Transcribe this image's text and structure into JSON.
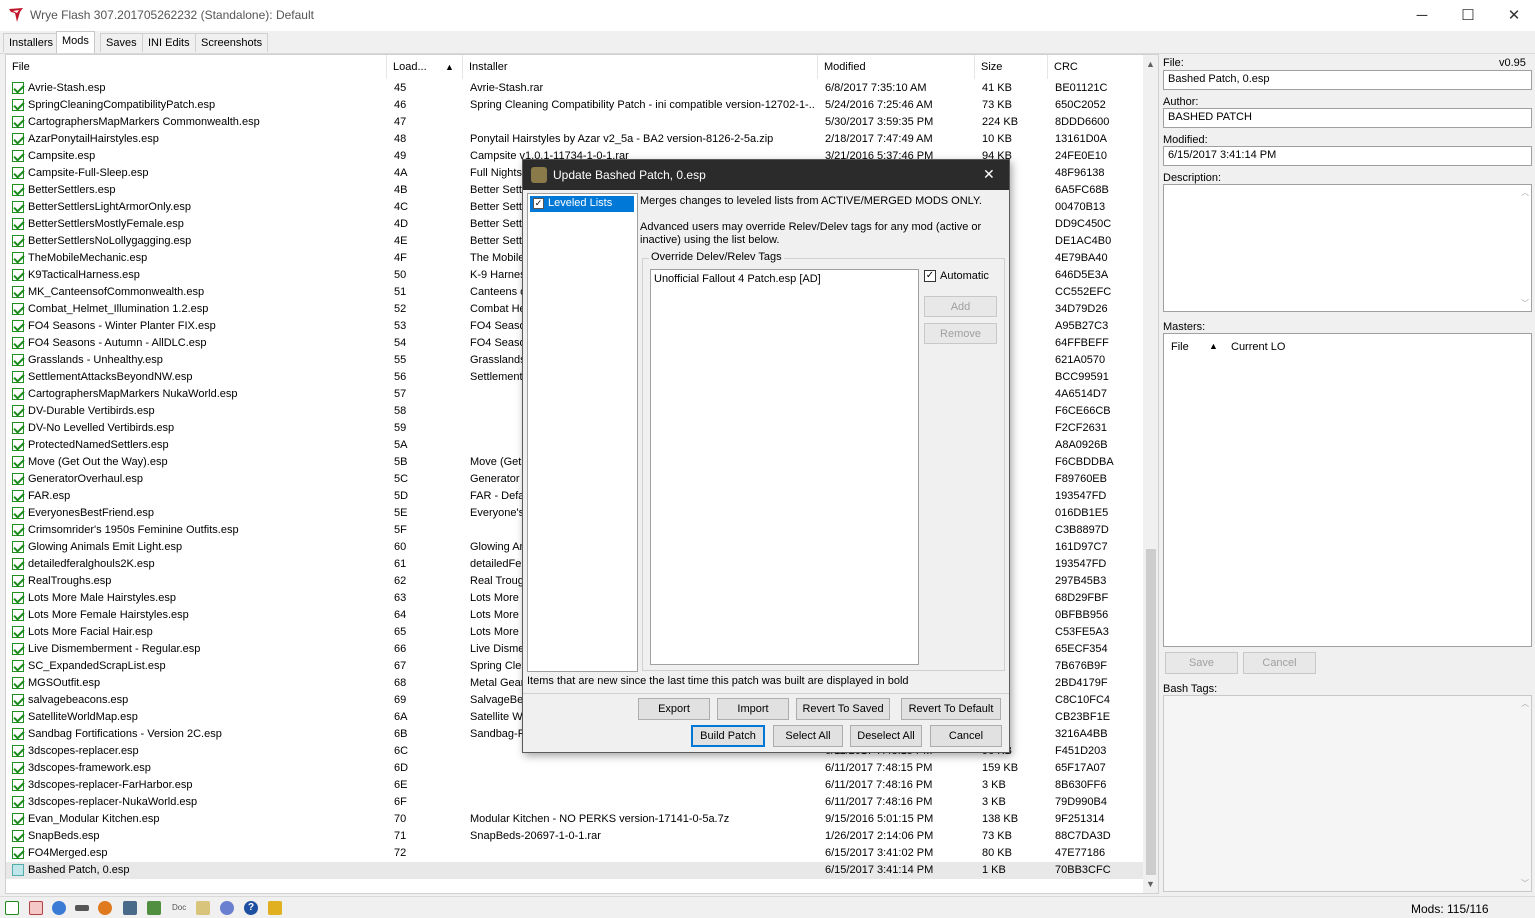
{
  "window": {
    "title": "Wrye Flash 307.201705262232 (Standalone): Default",
    "minimize": "─",
    "maximize": "☐",
    "close": "✕"
  },
  "tabs": [
    "Installers",
    "Mods",
    "Saves",
    "INI Edits",
    "Screenshots"
  ],
  "active_tab": "Mods",
  "columns": [
    "File",
    "Load...",
    "Installer",
    "Modified",
    "Size",
    "CRC"
  ],
  "sort_indicator": "▲",
  "mods": [
    {
      "file": "Avrie-Stash.esp",
      "load": "45",
      "installer": "Avrie-Stash.rar",
      "modified": "6/8/2017 7:35:10 AM",
      "size": "41 KB",
      "crc": "BE01121C"
    },
    {
      "file": "SpringCleaningCompatibilityPatch.esp",
      "load": "46",
      "installer": "Spring Cleaning Compatibility Patch - ini compatible version-12702-1-...",
      "modified": "5/24/2016 7:25:46 AM",
      "size": "73 KB",
      "crc": "650C2052"
    },
    {
      "file": "CartographersMapMarkers Commonwealth.esp",
      "load": "47",
      "installer": "",
      "modified": "5/30/2017 3:59:35 PM",
      "size": "224 KB",
      "crc": "8DDD6600"
    },
    {
      "file": "AzarPonytailHairstyles.esp",
      "load": "48",
      "installer": "Ponytail Hairstyles by Azar v2_5a - BA2 version-8126-2-5a.zip",
      "modified": "2/18/2017 7:47:49 AM",
      "size": "10 KB",
      "crc": "13161D0A"
    },
    {
      "file": "Campsite.esp",
      "load": "49",
      "installer": "Campsite v1.0.1-11734-1-0-1.rar",
      "modified": "3/21/2016 5:37:46 PM",
      "size": "94 KB",
      "crc": "24FE0E10"
    },
    {
      "file": "Campsite-Full-Sleep.esp",
      "load": "4A",
      "installer": "Full Nights'",
      "modified": "",
      "size": "",
      "crc": "48F96138"
    },
    {
      "file": "BetterSettlers.esp",
      "load": "4B",
      "installer": "Better Sett",
      "modified": "",
      "size": "",
      "crc": "6A5FC68B"
    },
    {
      "file": "BetterSettlersLightArmorOnly.esp",
      "load": "4C",
      "installer": "Better Sett",
      "modified": "",
      "size": "",
      "crc": "00470B13"
    },
    {
      "file": "BetterSettlersMostlyFemale.esp",
      "load": "4D",
      "installer": "Better Sett",
      "modified": "",
      "size": "",
      "crc": "DD9C450C"
    },
    {
      "file": "BetterSettlersNoLollygagging.esp",
      "load": "4E",
      "installer": "Better Sett",
      "modified": "",
      "size": "",
      "crc": "DE1AC4B0"
    },
    {
      "file": "TheMobileMechanic.esp",
      "load": "4F",
      "installer": "The Mobile",
      "modified": "",
      "size": "",
      "crc": "4E79BA40"
    },
    {
      "file": "K9TacticalHarness.esp",
      "load": "50",
      "installer": "K-9 Harnes",
      "modified": "",
      "size": "",
      "crc": "646D5E3A"
    },
    {
      "file": "MK_CanteensofCommonwealth.esp",
      "load": "51",
      "installer": "Canteens o",
      "modified": "",
      "size": "",
      "crc": "CC552EFC"
    },
    {
      "file": "Combat_Helmet_Illumination 1.2.esp",
      "load": "52",
      "installer": "Combat He",
      "modified": "",
      "size": "",
      "crc": "34D79D26"
    },
    {
      "file": "FO4 Seasons - Winter Planter FIX.esp",
      "load": "53",
      "installer": "FO4 Seaso",
      "modified": "",
      "size": "",
      "crc": "A95B27C3"
    },
    {
      "file": "FO4 Seasons - Autumn - AllDLC.esp",
      "load": "54",
      "installer": "FO4 Seaso",
      "modified": "",
      "size": "",
      "crc": "64FFBEFF"
    },
    {
      "file": "Grasslands - Unhealthy.esp",
      "load": "55",
      "installer": "Grasslands",
      "modified": "",
      "size": "",
      "crc": "621A0570"
    },
    {
      "file": "SettlementAttacksBeyondNW.esp",
      "load": "56",
      "installer": "Settlement",
      "modified": "",
      "size": "",
      "crc": "BCC99591"
    },
    {
      "file": "CartographersMapMarkers NukaWorld.esp",
      "load": "57",
      "installer": "",
      "modified": "",
      "size": "",
      "crc": "4A6514D7"
    },
    {
      "file": "DV-Durable Vertibirds.esp",
      "load": "58",
      "installer": "",
      "modified": "",
      "size": "",
      "crc": "F6CE66CB"
    },
    {
      "file": "DV-No Levelled Vertibirds.esp",
      "load": "59",
      "installer": "",
      "modified": "",
      "size": "",
      "crc": "F2CF2631"
    },
    {
      "file": "ProtectedNamedSettlers.esp",
      "load": "5A",
      "installer": "",
      "modified": "",
      "size": "",
      "crc": "A8A0926B"
    },
    {
      "file": "Move (Get Out the Way).esp",
      "load": "5B",
      "installer": "Move (Get",
      "modified": "",
      "size": "",
      "crc": "F6CBDDBA"
    },
    {
      "file": "GeneratorOverhaul.esp",
      "load": "5C",
      "installer": "Generator",
      "modified": "",
      "size": "",
      "crc": "F89760EB"
    },
    {
      "file": "FAR.esp",
      "load": "5D",
      "installer": "FAR - Defa",
      "modified": "",
      "size": "",
      "crc": "193547FD"
    },
    {
      "file": "EveryonesBestFriend.esp",
      "load": "5E",
      "installer": "Everyone's",
      "modified": "",
      "size": "",
      "crc": "016DB1E5"
    },
    {
      "file": "Crimsomrider's 1950s Feminine Outfits.esp",
      "load": "5F",
      "installer": "",
      "modified": "",
      "size": "",
      "crc": "C3B8897D"
    },
    {
      "file": "Glowing Animals Emit Light.esp",
      "load": "60",
      "installer": "Glowing An",
      "modified": "",
      "size": "",
      "crc": "161D97C7"
    },
    {
      "file": "detailedferalghouls2K.esp",
      "load": "61",
      "installer": "detailedFer",
      "modified": "",
      "size": "",
      "crc": "193547FD"
    },
    {
      "file": "RealTroughs.esp",
      "load": "62",
      "installer": "Real Troug",
      "modified": "",
      "size": "",
      "crc": "297B45B3"
    },
    {
      "file": "Lots More Male Hairstyles.esp",
      "load": "63",
      "installer": "Lots More",
      "modified": "",
      "size": "",
      "crc": "68D29FBF"
    },
    {
      "file": "Lots More Female Hairstyles.esp",
      "load": "64",
      "installer": "Lots More F",
      "modified": "",
      "size": "",
      "crc": "0BFBB956"
    },
    {
      "file": "Lots More Facial Hair.esp",
      "load": "65",
      "installer": "Lots More F",
      "modified": "",
      "size": "",
      "crc": "C53FE5A3"
    },
    {
      "file": "Live Dismemberment - Regular.esp",
      "load": "66",
      "installer": "Live Dismer",
      "modified": "",
      "size": "",
      "crc": "65ECF354"
    },
    {
      "file": "SC_ExpandedScrapList.esp",
      "load": "67",
      "installer": "Spring Clea",
      "modified": "",
      "size": "",
      "crc": "7B676B9F"
    },
    {
      "file": "MGSOutfit.esp",
      "load": "68",
      "installer": "Metal Gear",
      "modified": "",
      "size": "",
      "crc": "2BD4179F"
    },
    {
      "file": "salvagebeacons.esp",
      "load": "69",
      "installer": "SalvageBea",
      "modified": "",
      "size": "",
      "crc": "C8C10FC4"
    },
    {
      "file": "SatelliteWorldMap.esp",
      "load": "6A",
      "installer": "Satellite W",
      "modified": "",
      "size": "",
      "crc": "CB23BF1E"
    },
    {
      "file": "Sandbag Fortifications - Version 2C.esp",
      "load": "6B",
      "installer": "Sandbag-F",
      "modified": "",
      "size": "",
      "crc": "3216A4BB"
    },
    {
      "file": "3dscopes-replacer.esp",
      "load": "6C",
      "installer": "",
      "modified": "6/11/2017 7:48:15 PM",
      "size": "96 KB",
      "crc": "F451D203"
    },
    {
      "file": "3dscopes-framework.esp",
      "load": "6D",
      "installer": "",
      "modified": "6/11/2017 7:48:15 PM",
      "size": "159 KB",
      "crc": "65F17A07"
    },
    {
      "file": "3dscopes-replacer-FarHarbor.esp",
      "load": "6E",
      "installer": "",
      "modified": "6/11/2017 7:48:16 PM",
      "size": "3 KB",
      "crc": "8B630FF6"
    },
    {
      "file": "3dscopes-replacer-NukaWorld.esp",
      "load": "6F",
      "installer": "",
      "modified": "6/11/2017 7:48:16 PM",
      "size": "3 KB",
      "crc": "79D990B4"
    },
    {
      "file": "Evan_Modular Kitchen.esp",
      "load": "70",
      "installer": "Modular Kitchen - NO PERKS version-17141-0-5a.7z",
      "modified": "9/15/2016 5:01:15 PM",
      "size": "138 KB",
      "crc": "9F251314"
    },
    {
      "file": "SnapBeds.esp",
      "load": "71",
      "installer": "SnapBeds-20697-1-0-1.rar",
      "modified": "1/26/2017 2:14:06 PM",
      "size": "73 KB",
      "crc": "88C7DA3D"
    },
    {
      "file": "FO4Merged.esp",
      "load": "72",
      "installer": "",
      "modified": "6/15/2017 3:41:02 PM",
      "size": "80 KB",
      "crc": "47E77186"
    },
    {
      "file": "Bashed Patch, 0.esp",
      "load": "",
      "installer": "",
      "modified": "6/15/2017 3:41:14 PM",
      "size": "1 KB",
      "crc": "70BB3CFC"
    }
  ],
  "details": {
    "file_label": "File:",
    "version": "v0.95",
    "file_value": "Bashed Patch, 0.esp",
    "author_label": "Author:",
    "author_value": "BASHED PATCH",
    "modified_label": "Modified:",
    "modified_value": "6/15/2017 3:41:14 PM",
    "description_label": "Description:",
    "masters_label": "Masters:",
    "masters_col_file": "File",
    "masters_col_lo": "Current LO",
    "save": "Save",
    "cancel": "Cancel",
    "bash_tags_label": "Bash Tags:"
  },
  "status": {
    "mods_count": "Mods: 115/116",
    "icon_doc_label": "Doc"
  },
  "dialog": {
    "title": "Update Bashed Patch, 0.esp",
    "close": "✕",
    "list_item": "Leveled Lists",
    "desc1": "Merges changes to leveled lists from ACTIVE/MERGED MODS ONLY.",
    "desc2": "Advanced users may override Relev/Delev tags for any mod (active or inactive) using the list below.",
    "group_label": "Override Delev/Relev Tags",
    "override_item": "Unofficial Fallout 4 Patch.esp [AD]",
    "automatic": "Automatic",
    "add": "Add",
    "remove": "Remove",
    "footer_note": "Items that are new since the last time this patch was built are displayed in bold",
    "export": "Export",
    "import": "Import",
    "revert_saved": "Revert To Saved",
    "revert_default": "Revert To Default",
    "build": "Build Patch",
    "select_all": "Select All",
    "deselect_all": "Deselect All",
    "cancel": "Cancel"
  }
}
